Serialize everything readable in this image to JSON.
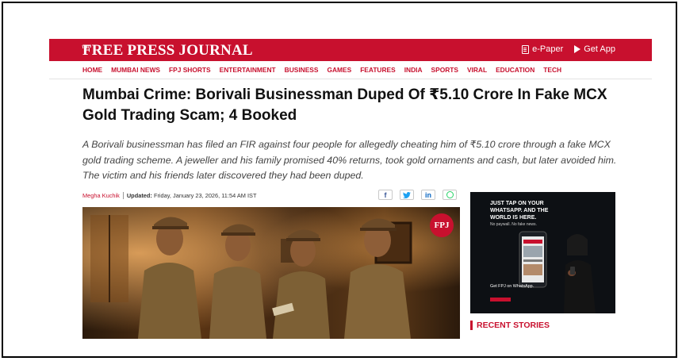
{
  "header": {
    "logo_the": "THE",
    "logo": "FREE PRESS JOURNAL",
    "epaper_label": "e-Paper",
    "getapp_label": "Get App"
  },
  "nav": {
    "items": [
      "HOME",
      "MUMBAI NEWS",
      "FPJ SHORTS",
      "ENTERTAINMENT",
      "BUSINESS",
      "GAMES",
      "FEATURES",
      "INDIA",
      "SPORTS",
      "VIRAL",
      "EDUCATION",
      "TECH"
    ]
  },
  "article": {
    "headline": "Mumbai Crime: Borivali Businessman Duped Of ₹5.10 Crore In Fake MCX Gold Trading Scam; 4 Booked",
    "summary": "A Borivali businessman has filed an FIR against four people for allegedly cheating him of ₹5.10 crore through a fake MCX gold trading scheme. A jeweller and his family promised 40% returns, took gold ornaments and cash, but later avoided him. The victim and his friends later discovered they had been duped.",
    "author": "Megha Kuchik",
    "updated_label": "Updated:",
    "updated_value": "Friday, January 23, 2026, 11:54 AM IST",
    "image_badge": "FPJ"
  },
  "share": {
    "facebook": "f",
    "twitter": "t",
    "linkedin": "in",
    "whatsapp_icon": "whatsapp-icon"
  },
  "ad": {
    "headline": "JUST TAP ON YOUR WHATSAPP. AND THE WORLD IS HERE.",
    "sub": "No paywall. No fake news.",
    "cta": "Get FPJ on WhatsApp."
  },
  "sidebar": {
    "recent_title": "RECENT STORIES"
  },
  "colors": {
    "brand_red": "#c8102e",
    "text_dark": "#111111",
    "text_muted": "#444444"
  }
}
